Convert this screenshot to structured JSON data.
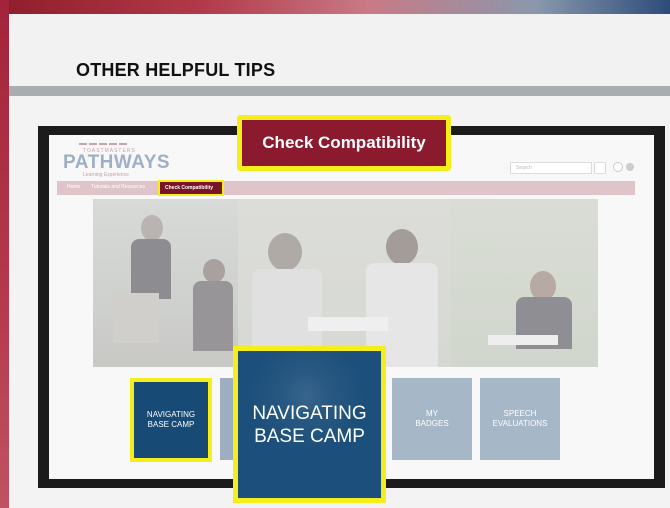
{
  "slide": {
    "title": "OTHER HELPFUL TIPS"
  },
  "site": {
    "logo_small": "TOASTMASTERS",
    "logo_main": "PATHWAYS",
    "logo_sub": "Learning Experience",
    "search_placeholder": "Search"
  },
  "nav": {
    "items": [
      "Home",
      "Tutorials and Resources",
      "Check Compatibility"
    ]
  },
  "tiles": [
    {
      "label_line1": "NAVIGATING",
      "label_line2": "BASE CAMP"
    },
    {
      "label_line1": "MY",
      "label_line2": "BADGES"
    },
    {
      "label_line1": "SPEECH",
      "label_line2": "EVALUATIONS"
    }
  ],
  "callouts": {
    "compatibility": "Check Compatibility",
    "base_camp_line1": "NAVIGATING",
    "base_camp_line2": "BASE CAMP"
  },
  "colors": {
    "highlight": "#f5ee1a",
    "brand_red": "#8b1a2e",
    "tile_blue": "#1c4f7b"
  }
}
